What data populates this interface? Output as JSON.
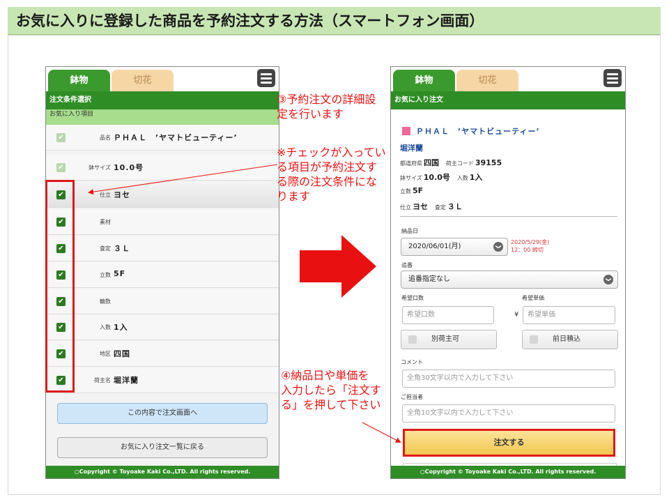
{
  "slide": {
    "title": "お気に入りに登録した商品を予約注文する方法（スマートフォン画面）"
  },
  "left_phone": {
    "tabs": [
      "鉢物",
      "切花"
    ],
    "header": "注文条件選択",
    "section_label": "お気に入り項目",
    "rows": [
      {
        "label": "品名",
        "value": "ＰＨＡＬ　’ヤマトビューティー’",
        "checked": "dim"
      },
      {
        "label": "鉢サイズ",
        "value": "10.0号",
        "checked": "dim"
      },
      {
        "label": "仕立",
        "value": "ヨセ",
        "checked": "on"
      },
      {
        "label": "素材",
        "value": "",
        "checked": "on"
      },
      {
        "label": "査定",
        "value": "３Ｌ",
        "checked": "on"
      },
      {
        "label": "立数",
        "value": "5F",
        "checked": "on"
      },
      {
        "label": "輪数",
        "value": "",
        "checked": "on"
      },
      {
        "label": "入数",
        "value": "1入",
        "checked": "on"
      },
      {
        "label": "地区",
        "value": "四国",
        "checked": "on"
      },
      {
        "label": "荷主名",
        "value": "堀洋蘭",
        "checked": "on"
      }
    ],
    "buttons": {
      "to_order": "この内容で注文画面へ",
      "back": "お気に入り注文一覧に戻る"
    },
    "footer": "○Copyright © Toyoake Kaki Co.,LTD. All rights reserved.",
    "checkmark": "✔"
  },
  "right_phone": {
    "tabs": [
      "鉢物",
      "切花"
    ],
    "header": "お気に入り注文",
    "product_name": "ＰＨＡＬ　’ヤマトビューティー’",
    "grower": "堀洋蘭",
    "info": {
      "pref_label": "都道府県",
      "pref": "四国",
      "shipper_code_label": "荷主コード",
      "shipper_code": "39155",
      "pot_label": "鉢サイズ",
      "pot": "10.0号",
      "qty_label": "入数",
      "qty": "1入",
      "stems_label": "立数",
      "stems": "5F",
      "style_label": "仕立",
      "style": "ヨセ",
      "grade_label": "査定",
      "grade": "３Ｌ"
    },
    "delivery_label": "納品日",
    "delivery_value": "2020/06/01(月)",
    "deadline_date": "2020/5/29(金)",
    "deadline_time": "12：00 締切",
    "chase_label": "追番",
    "chase_value": "追番指定なし",
    "units_label": "希望口数",
    "units_placeholder": "希望口数",
    "price_label": "希望単価",
    "price_placeholder": "希望単価",
    "currency": "¥",
    "separate_label": "別荷主可",
    "prevday_label": "前日積込",
    "comment_label": "コメント",
    "comment_placeholder": "全角30文字以内で入力して下さい",
    "contact_label": "ご担当者",
    "contact_placeholder": "全角10文字以内で入力して下さい",
    "order_button": "注文する",
    "footer": "○Copyright © Toyoake Kaki Co.,LTD. All rights reserved.",
    "chevron": "❯"
  },
  "annotations": {
    "a1": [
      "③予約注文の詳細設",
      "定を行います"
    ],
    "a2": [
      "※チェックが入ってい",
      "る項目が予約注文す",
      "る際の注文条件にな",
      "ります"
    ],
    "a3": [
      "④納品日や単価を",
      "入力したら「注文す",
      "る」を押して下さい"
    ]
  },
  "colors": {
    "accent_green": "#2f8d26",
    "highlight_red": "#dd1a1a",
    "annotation_red": "#ee1111"
  }
}
